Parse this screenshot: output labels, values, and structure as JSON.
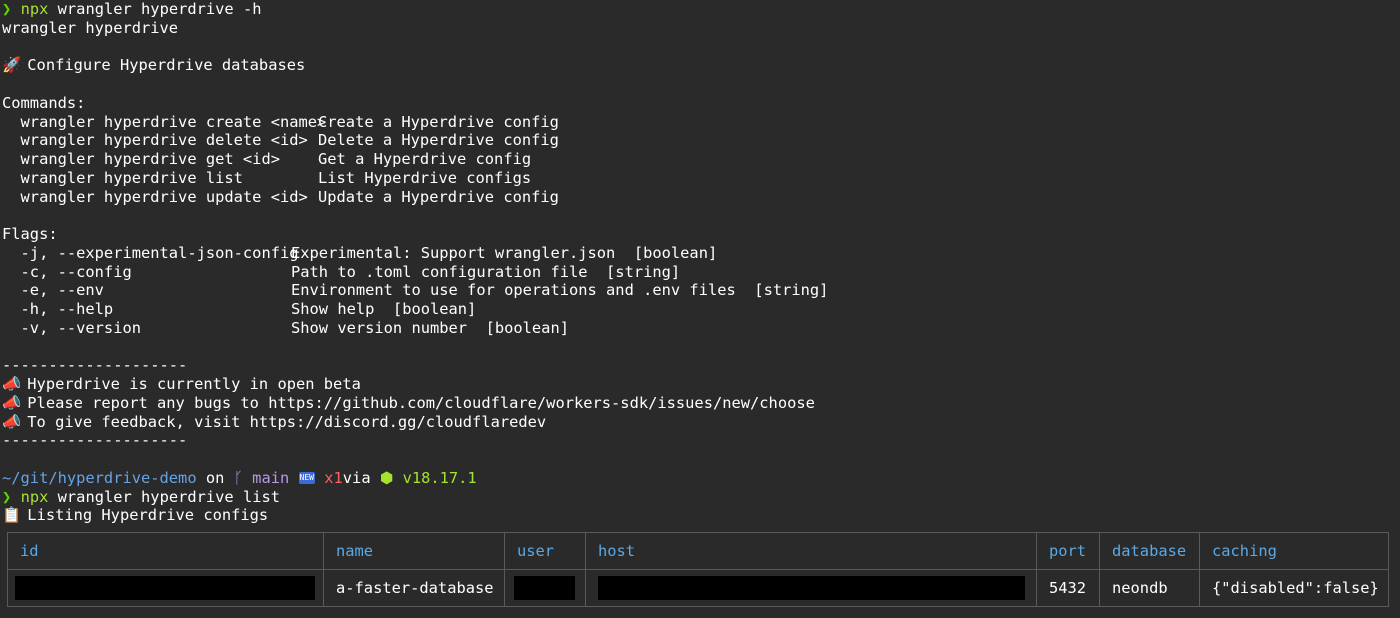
{
  "first_prompt": {
    "arrow": "❯",
    "command_program": "npx",
    "command_rest": " wrangler hyperdrive -h"
  },
  "help": {
    "usage": "wrangler hyperdrive",
    "description": "Configure Hyperdrive databases",
    "description_icon": "rocket-icon",
    "commands_header": "Commands:",
    "commands": [
      {
        "name": "  wrangler hyperdrive create <name>",
        "desc": "Create a Hyperdrive config"
      },
      {
        "name": "  wrangler hyperdrive delete <id>",
        "desc": "Delete a Hyperdrive config"
      },
      {
        "name": "  wrangler hyperdrive get <id>",
        "desc": "Get a Hyperdrive config"
      },
      {
        "name": "  wrangler hyperdrive list",
        "desc": "List Hyperdrive configs"
      },
      {
        "name": "  wrangler hyperdrive update <id>",
        "desc": "Update a Hyperdrive config"
      }
    ],
    "flags_header": "Flags:",
    "flags": [
      {
        "name": "  -j, --experimental-json-config",
        "desc": "Experimental: Support wrangler.json  [boolean]"
      },
      {
        "name": "  -c, --config",
        "desc": "Path to .toml configuration file  [string]"
      },
      {
        "name": "  -e, --env",
        "desc": "Environment to use for operations and .env files  [string]"
      },
      {
        "name": "  -h, --help",
        "desc": "Show help  [boolean]"
      },
      {
        "name": "  -v, --version",
        "desc": "Show version number  [boolean]"
      }
    ],
    "separator": "--------------------",
    "beta_notices": [
      "Hyperdrive is currently in open beta",
      "Please report any bugs to https://github.com/cloudflare/workers-sdk/issues/new/choose",
      "To give feedback, visit https://discord.gg/cloudflaredev"
    ]
  },
  "status_line": {
    "path": "~/git/hyperdrive-demo",
    "on": " on ",
    "branch_icon": "git-branch-icon",
    "branch": " main ",
    "new_badge": "NEW",
    "modified": " x1",
    "via": "via ",
    "node_icon": "nodejs-icon",
    "node_version": " v18.17.1"
  },
  "second_prompt": {
    "arrow": "❯",
    "command_program": "npx",
    "command_rest": " wrangler hyperdrive list"
  },
  "listing_text": "Listing Hyperdrive configs",
  "listing_icon": "clipboard-icon",
  "table": {
    "headers": [
      "id",
      "name",
      "user",
      "host",
      "port",
      "database",
      "caching"
    ],
    "rows": [
      {
        "id": "",
        "name": "a-faster-database",
        "user": "",
        "host": "",
        "port": "5432",
        "database": "neondb",
        "caching": "{\"disabled\":false}"
      }
    ]
  },
  "colors": {
    "background": "#2a2a2a",
    "prompt_arrow": "#5fd700",
    "path": "#66a3e6",
    "branch": "#b59ae6",
    "table_header": "#5aa9e6"
  }
}
